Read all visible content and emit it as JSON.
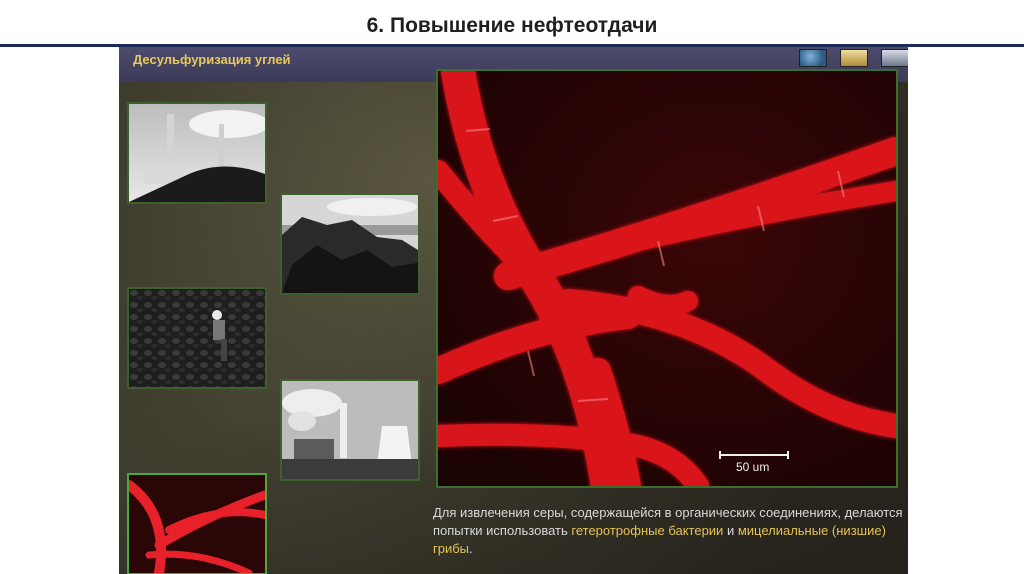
{
  "slide": {
    "title": "6. Повышение нефтеотдачи"
  },
  "app": {
    "header_title": "Десульфуризация углей",
    "toolbar": {
      "icons": [
        "globe-icon",
        "book-icon",
        "panel-icon"
      ]
    }
  },
  "thumbnails": [
    {
      "name": "thumb-power-plant-coal-pile"
    },
    {
      "name": "thumb-coal-rocks"
    },
    {
      "name": "thumb-coal-worker"
    },
    {
      "name": "thumb-power-plant-smoke"
    },
    {
      "name": "thumb-bacteria-selected"
    }
  ],
  "main_image": {
    "scale_label": "50 um"
  },
  "caption": {
    "part1": "Для извлечения серы, содержащейся в органических соединениях, делаются попытки использовать ",
    "highlight1": "гетеротрофные бактерии",
    "part2": " и ",
    "highlight2": "мицелиальные (низшие) грибы",
    "part3": "."
  },
  "colors": {
    "accent_title": "#e8c95a",
    "highlight": "#e6c357",
    "header_bg": "#3b3a57",
    "frame_green": "#3e6e2e"
  }
}
